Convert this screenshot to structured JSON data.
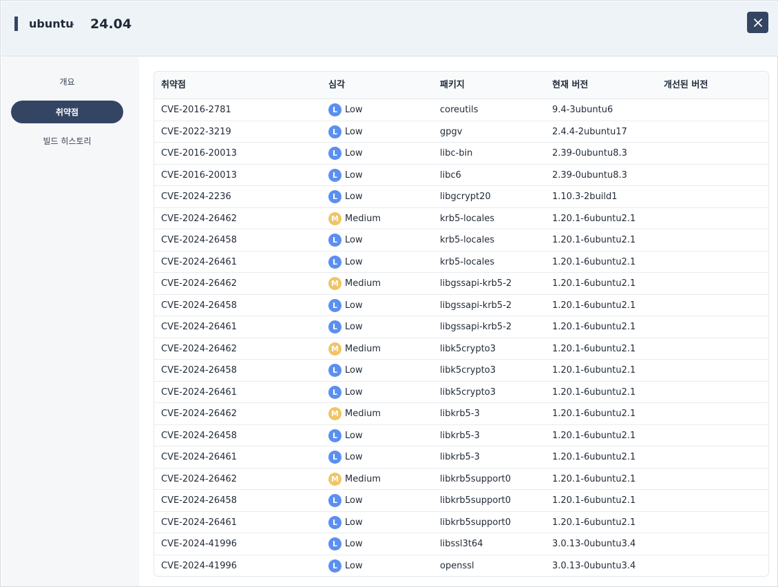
{
  "header": {
    "breadcrumb": "ubuntu",
    "chevron": "›",
    "title": "24.04",
    "close_icon": "close-icon"
  },
  "sidebar": {
    "items": [
      {
        "label": "개요",
        "active": false
      },
      {
        "label": "취약점",
        "active": true
      },
      {
        "label": "빌드 히스토리",
        "active": false
      }
    ]
  },
  "table": {
    "columns": [
      "취약점",
      "심각",
      "패키지",
      "현재 버전",
      "개선된 버전"
    ],
    "colors": {
      "low": "#5b8ff0",
      "medium": "#f0c566"
    },
    "rows": [
      {
        "cve": "CVE-2016-2781",
        "sev_letter": "L",
        "severity": "Low",
        "package": "coreutils",
        "current": "9.4-3ubuntu6",
        "fixed": ""
      },
      {
        "cve": "CVE-2022-3219",
        "sev_letter": "L",
        "severity": "Low",
        "package": "gpgv",
        "current": "2.4.4-2ubuntu17",
        "fixed": ""
      },
      {
        "cve": "CVE-2016-20013",
        "sev_letter": "L",
        "severity": "Low",
        "package": "libc-bin",
        "current": "2.39-0ubuntu8.3",
        "fixed": ""
      },
      {
        "cve": "CVE-2016-20013",
        "sev_letter": "L",
        "severity": "Low",
        "package": "libc6",
        "current": "2.39-0ubuntu8.3",
        "fixed": ""
      },
      {
        "cve": "CVE-2024-2236",
        "sev_letter": "L",
        "severity": "Low",
        "package": "libgcrypt20",
        "current": "1.10.3-2build1",
        "fixed": ""
      },
      {
        "cve": "CVE-2024-26462",
        "sev_letter": "M",
        "severity": "Medium",
        "package": "krb5-locales",
        "current": "1.20.1-6ubuntu2.1",
        "fixed": ""
      },
      {
        "cve": "CVE-2024-26458",
        "sev_letter": "L",
        "severity": "Low",
        "package": "krb5-locales",
        "current": "1.20.1-6ubuntu2.1",
        "fixed": ""
      },
      {
        "cve": "CVE-2024-26461",
        "sev_letter": "L",
        "severity": "Low",
        "package": "krb5-locales",
        "current": "1.20.1-6ubuntu2.1",
        "fixed": ""
      },
      {
        "cve": "CVE-2024-26462",
        "sev_letter": "M",
        "severity": "Medium",
        "package": "libgssapi-krb5-2",
        "current": "1.20.1-6ubuntu2.1",
        "fixed": ""
      },
      {
        "cve": "CVE-2024-26458",
        "sev_letter": "L",
        "severity": "Low",
        "package": "libgssapi-krb5-2",
        "current": "1.20.1-6ubuntu2.1",
        "fixed": ""
      },
      {
        "cve": "CVE-2024-26461",
        "sev_letter": "L",
        "severity": "Low",
        "package": "libgssapi-krb5-2",
        "current": "1.20.1-6ubuntu2.1",
        "fixed": ""
      },
      {
        "cve": "CVE-2024-26462",
        "sev_letter": "M",
        "severity": "Medium",
        "package": "libk5crypto3",
        "current": "1.20.1-6ubuntu2.1",
        "fixed": ""
      },
      {
        "cve": "CVE-2024-26458",
        "sev_letter": "L",
        "severity": "Low",
        "package": "libk5crypto3",
        "current": "1.20.1-6ubuntu2.1",
        "fixed": ""
      },
      {
        "cve": "CVE-2024-26461",
        "sev_letter": "L",
        "severity": "Low",
        "package": "libk5crypto3",
        "current": "1.20.1-6ubuntu2.1",
        "fixed": ""
      },
      {
        "cve": "CVE-2024-26462",
        "sev_letter": "M",
        "severity": "Medium",
        "package": "libkrb5-3",
        "current": "1.20.1-6ubuntu2.1",
        "fixed": ""
      },
      {
        "cve": "CVE-2024-26458",
        "sev_letter": "L",
        "severity": "Low",
        "package": "libkrb5-3",
        "current": "1.20.1-6ubuntu2.1",
        "fixed": ""
      },
      {
        "cve": "CVE-2024-26461",
        "sev_letter": "L",
        "severity": "Low",
        "package": "libkrb5-3",
        "current": "1.20.1-6ubuntu2.1",
        "fixed": ""
      },
      {
        "cve": "CVE-2024-26462",
        "sev_letter": "M",
        "severity": "Medium",
        "package": "libkrb5support0",
        "current": "1.20.1-6ubuntu2.1",
        "fixed": ""
      },
      {
        "cve": "CVE-2024-26458",
        "sev_letter": "L",
        "severity": "Low",
        "package": "libkrb5support0",
        "current": "1.20.1-6ubuntu2.1",
        "fixed": ""
      },
      {
        "cve": "CVE-2024-26461",
        "sev_letter": "L",
        "severity": "Low",
        "package": "libkrb5support0",
        "current": "1.20.1-6ubuntu2.1",
        "fixed": ""
      },
      {
        "cve": "CVE-2024-41996",
        "sev_letter": "L",
        "severity": "Low",
        "package": "libssl3t64",
        "current": "3.0.13-0ubuntu3.4",
        "fixed": ""
      },
      {
        "cve": "CVE-2024-41996",
        "sev_letter": "L",
        "severity": "Low",
        "package": "openssl",
        "current": "3.0.13-0ubuntu3.4",
        "fixed": ""
      }
    ]
  }
}
